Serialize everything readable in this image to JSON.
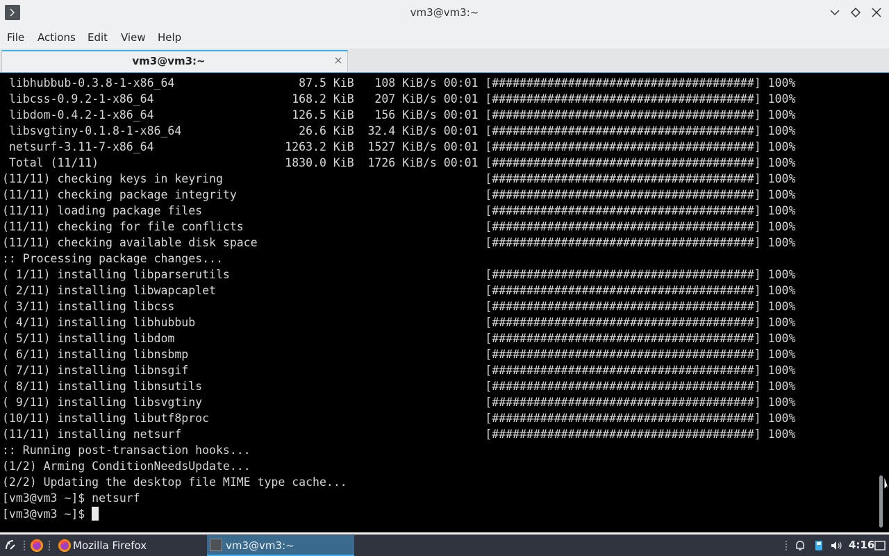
{
  "window": {
    "title": "vm3@vm3:~"
  },
  "menu": {
    "items": [
      "File",
      "Actions",
      "Edit",
      "View",
      "Help"
    ]
  },
  "tabs": [
    {
      "label": "vm3@vm3:~",
      "active": true
    }
  ],
  "terminal": {
    "lines": [
      " libhubbub-0.3.8-1-x86_64                  87.5 KiB   108 KiB/s 00:01 [######################################] 100%",
      " libcss-0.9.2-1-x86_64                    168.2 KiB   207 KiB/s 00:01 [######################################] 100%",
      " libdom-0.4.2-1-x86_64                    126.5 KiB   156 KiB/s 00:01 [######################################] 100%",
      " libsvgtiny-0.1.8-1-x86_64                 26.6 KiB  32.4 KiB/s 00:01 [######################################] 100%",
      " netsurf-3.11-7-x86_64                   1263.2 KiB  1527 KiB/s 00:01 [######################################] 100%",
      " Total (11/11)                           1830.0 KiB  1726 KiB/s 00:01 [######################################] 100%",
      "(11/11) checking keys in keyring                                      [######################################] 100%",
      "(11/11) checking package integrity                                    [######################################] 100%",
      "(11/11) loading package files                                         [######################################] 100%",
      "(11/11) checking for file conflicts                                   [######################################] 100%",
      "(11/11) checking available disk space                                 [######################################] 100%",
      ":: Processing package changes...",
      "( 1/11) installing libparserutils                                     [######################################] 100%",
      "( 2/11) installing libwapcaplet                                       [######################################] 100%",
      "( 3/11) installing libcss                                             [######################################] 100%",
      "( 4/11) installing libhubbub                                          [######################################] 100%",
      "( 5/11) installing libdom                                             [######################################] 100%",
      "( 6/11) installing libnsbmp                                           [######################################] 100%",
      "( 7/11) installing libnsgif                                           [######################################] 100%",
      "( 8/11) installing libnsutils                                         [######################################] 100%",
      "( 9/11) installing libsvgtiny                                         [######################################] 100%",
      "(10/11) installing libutf8proc                                        [######################################] 100%",
      "(11/11) installing netsurf                                            [######################################] 100%",
      ":: Running post-transaction hooks...",
      "(1/2) Arming ConditionNeedsUpdate...",
      "(2/2) Updating the desktop file MIME type cache...",
      "[vm3@vm3 ~]$ netsurf"
    ],
    "prompt": "[vm3@vm3 ~]$ "
  },
  "taskbar": {
    "tasks": [
      {
        "label": "Mozilla Firefox",
        "icon": "firefox-icon",
        "active": false
      },
      {
        "label": "vm3@vm3:~",
        "icon": "terminal-icon",
        "active": true
      }
    ],
    "clock": "4:16"
  },
  "colors": {
    "accent": "#3daee9",
    "terminal_bg": "#000000",
    "terminal_fg": "#d6d6d6",
    "taskbar_bg": "#2f343f"
  }
}
